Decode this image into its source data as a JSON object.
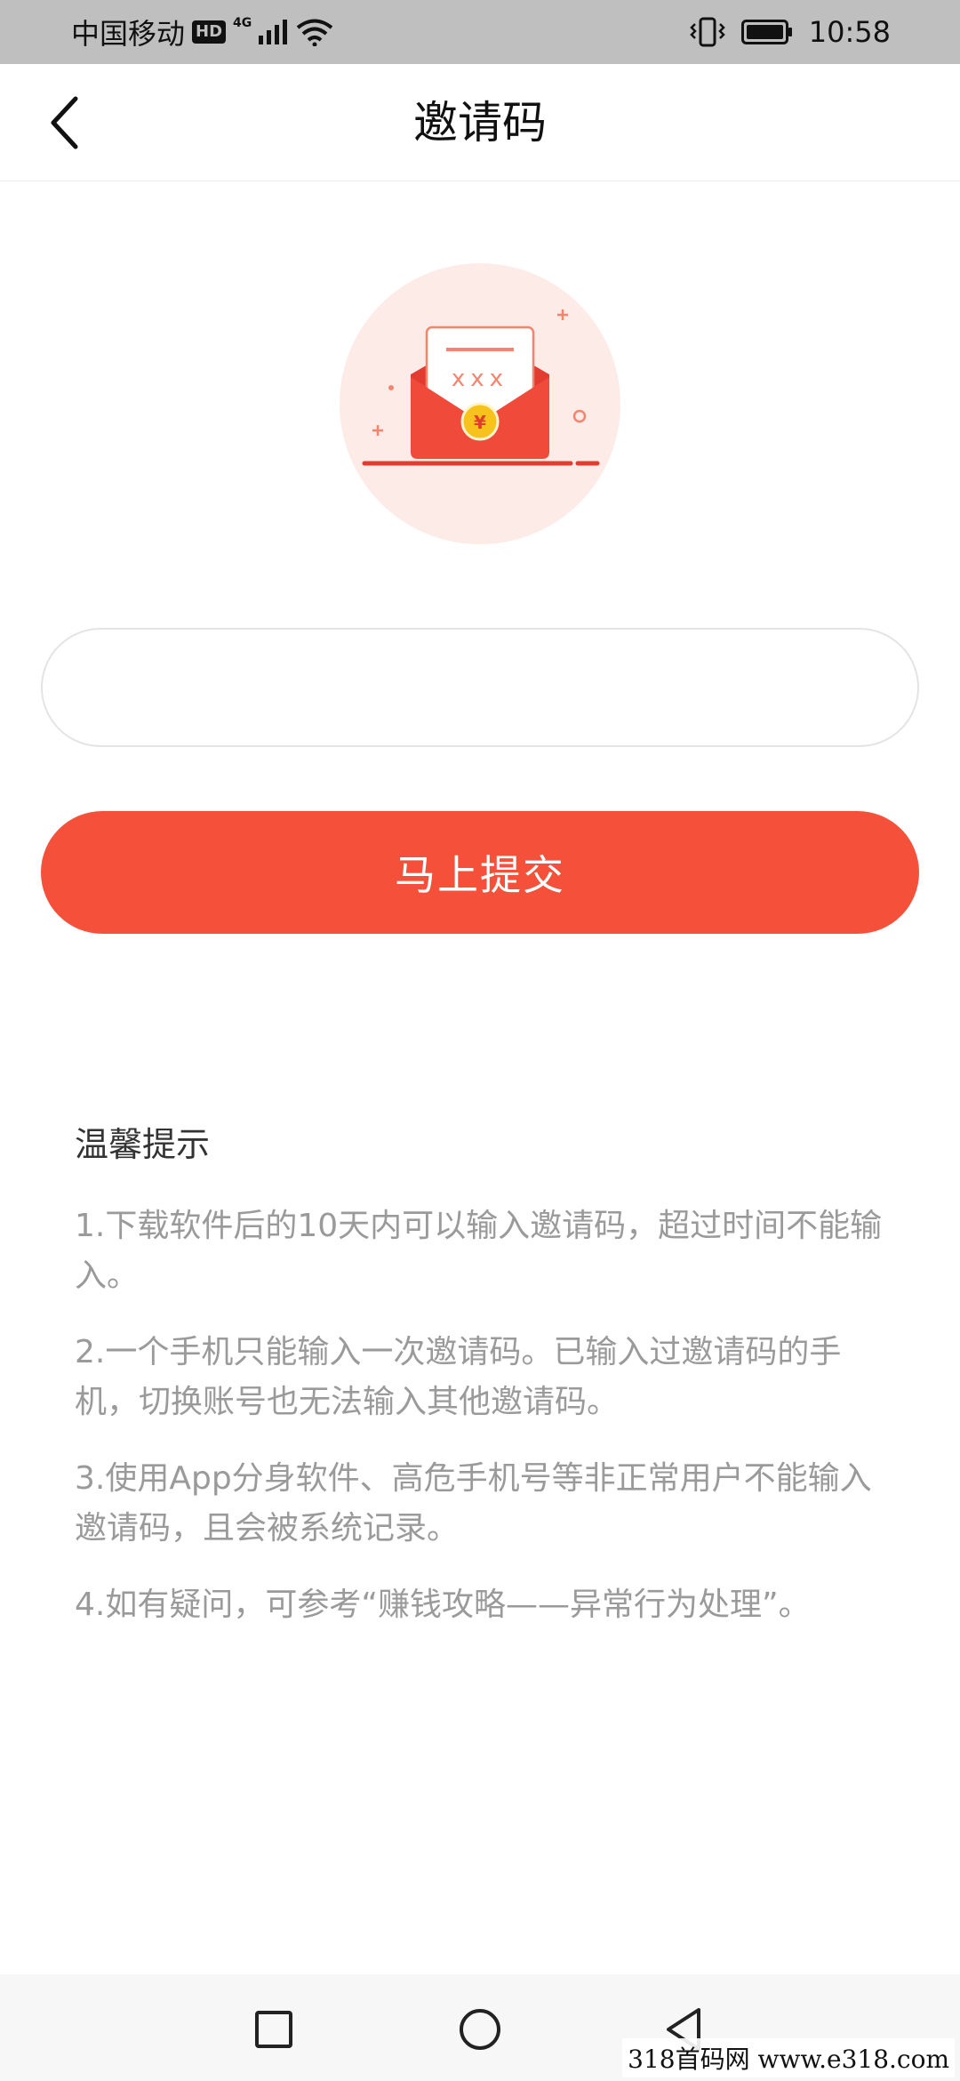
{
  "status_bar": {
    "carrier": "中国移动",
    "hd_badge": "HD",
    "network": "4G",
    "time": "10:58",
    "icons": [
      "hd-icon",
      "signal-icon",
      "wifi-icon",
      "vibrate-icon",
      "battery-icon"
    ]
  },
  "nav": {
    "title": "邀请码",
    "back_icon": "chevron-left-icon"
  },
  "illustration": {
    "letter_text": "xxx",
    "coin_symbol": "¥",
    "colors": {
      "circle_bg": "#fdebe8",
      "envelope": "#f04a3b",
      "coin": "#f7c21b"
    }
  },
  "invite_input": {
    "value": "",
    "placeholder": ""
  },
  "submit": {
    "label": "马上提交",
    "color": "#f5513a"
  },
  "tips": {
    "title": "温馨提示",
    "items": [
      "1.下载软件后的10天内可以输入邀请码，超过时间不能输入。",
      "2.一个手机只能输入一次邀请码。已输入过邀请码的手机，切换账号也无法输入其他邀请码。",
      "3.使用App分身软件、高危手机号等非正常用户不能输入邀请码，且会被系统记录。",
      "4.如有疑问，可参考“赚钱攻略——异常行为处理”。"
    ]
  },
  "bottom_nav": {
    "icons": [
      "recent-apps-icon",
      "home-icon",
      "back-icon"
    ]
  },
  "watermark": "318首码网 www.e318.com"
}
